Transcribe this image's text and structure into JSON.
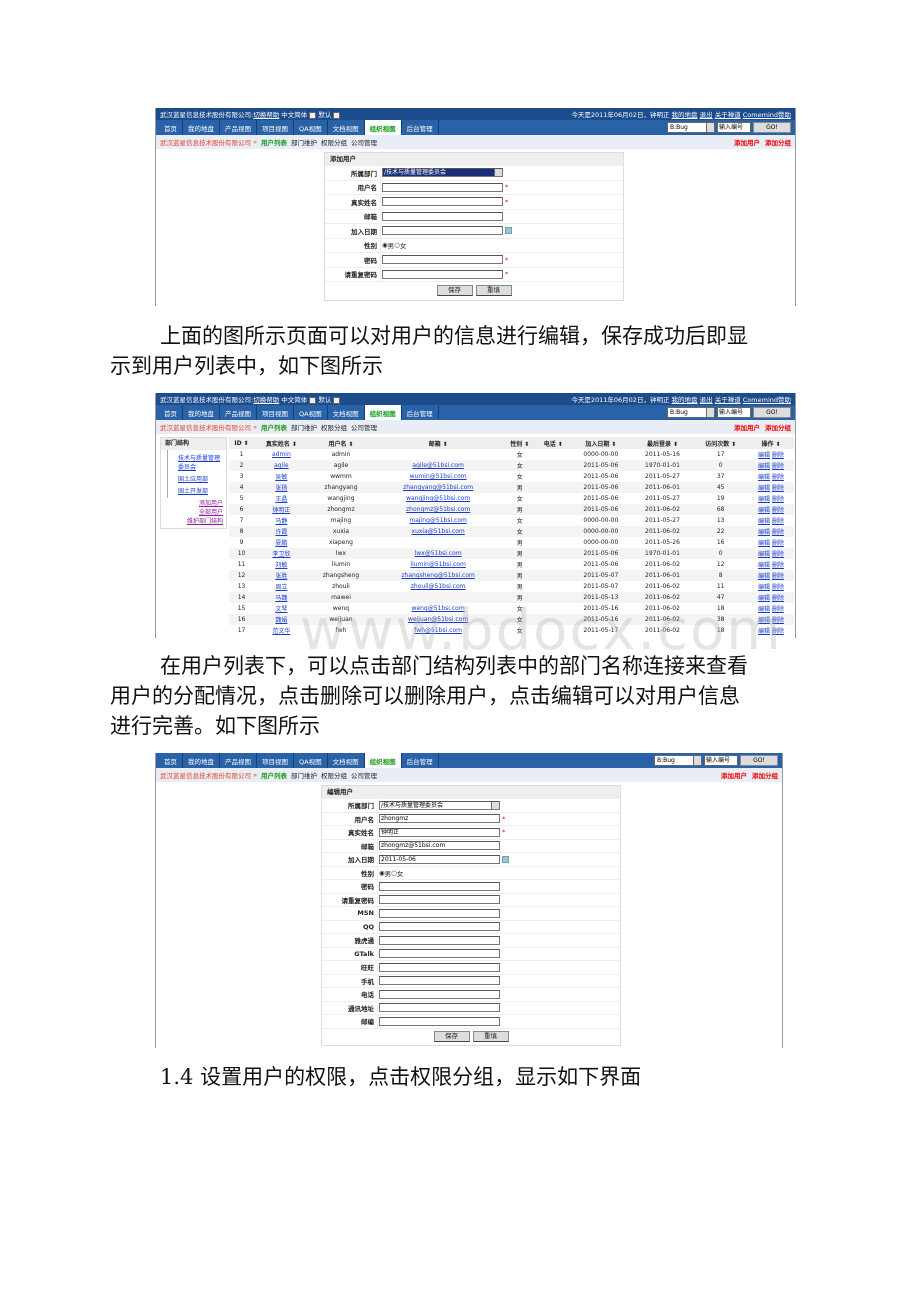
{
  "app": {
    "company": "武汉蓝星信息技术股份有限公司",
    "help": "切换帮助",
    "lang": "中文简体",
    "theme": "默认",
    "today": "今天是2011年06月02日，钟明正",
    "top_links": [
      "我的地盘",
      "退出",
      "关于禅道",
      "Comemind赞助"
    ],
    "tabs": [
      "首页",
      "我的地盘",
      "产品视图",
      "项目视图",
      "QA视图",
      "文档视图",
      "组织视图",
      "后台管理"
    ],
    "active_tab": "组织视图",
    "search_type": "B:Bug",
    "search_placeholder": "输入编号",
    "go": "GO!",
    "sub_current": "用户列表",
    "sub_links": [
      "部门维护",
      "权限分组",
      "公司管理"
    ],
    "sub_actions": [
      "添加用户",
      "添加分组"
    ],
    "colors": {
      "topbar": "#1d4c8c",
      "nav": "#2a62a8",
      "active": "#1a9a1a",
      "action": "#e00000"
    }
  },
  "add_form": {
    "title": "添加用户",
    "rows": [
      {
        "label": "所属部门",
        "type": "select",
        "value": "/技术与质量管理委员会"
      },
      {
        "label": "用户名",
        "type": "text",
        "value": "",
        "required": true
      },
      {
        "label": "真实姓名",
        "type": "text",
        "value": "",
        "required": true
      },
      {
        "label": "邮箱",
        "type": "text",
        "value": ""
      },
      {
        "label": "加入日期",
        "type": "date",
        "value": ""
      },
      {
        "label": "性别",
        "type": "radio",
        "options": [
          "男",
          "女"
        ],
        "selected": "男"
      },
      {
        "label": "密码",
        "type": "password",
        "value": "",
        "required": true
      },
      {
        "label": "请重复密码",
        "type": "password",
        "value": "",
        "required": true
      }
    ],
    "save": "保存",
    "reset": "重填"
  },
  "para1": [
    "上面的图所示页面可以对用户的信息进行编辑，保存成功后即显",
    "示到用户列表中，如下图所示"
  ],
  "user_list": {
    "side_title": "部门结构",
    "departments": [
      "技术与质量管理委员会",
      "国土应用部",
      "国土开发部"
    ],
    "side_links": [
      "添加用户",
      "全部用户",
      "维护部门结构"
    ],
    "columns": [
      "ID",
      "真实姓名",
      "用户名",
      "邮箱",
      "性别",
      "电话",
      "加入日期",
      "最后登录",
      "访问次数",
      "操作"
    ],
    "actions": [
      "编辑",
      "删除"
    ],
    "rows": [
      [
        "1",
        "admin",
        "admin",
        "",
        "女",
        "",
        "0000-00-00",
        "2011-05-16",
        "17"
      ],
      [
        "2",
        "agile",
        "agile",
        "agile@51bsi.com",
        "女",
        "",
        "2011-05-06",
        "1970-01-01",
        "0"
      ],
      [
        "3",
        "吴敏",
        "wwmm",
        "wumin@51bsi.com",
        "女",
        "",
        "2011-05-06",
        "2011-05-27",
        "37"
      ],
      [
        "4",
        "张扬",
        "zhangyang",
        "zhangyang@51bsi.com",
        "男",
        "",
        "2011-05-06",
        "2011-06-01",
        "45"
      ],
      [
        "5",
        "王晶",
        "wangjing",
        "wangjing@51bsi.com",
        "女",
        "",
        "2011-05-06",
        "2011-05-27",
        "19"
      ],
      [
        "6",
        "钟明正",
        "zhongmz",
        "zhongmz@51bsi.com",
        "男",
        "",
        "2011-05-06",
        "2011-06-02",
        "68"
      ],
      [
        "7",
        "马静",
        "majing",
        "majing@51bsi.com",
        "女",
        "",
        "0000-00-00",
        "2011-05-27",
        "13"
      ],
      [
        "8",
        "许霞",
        "xuxia",
        "xuxia@51bsi.com",
        "女",
        "",
        "0000-00-00",
        "2011-06-02",
        "22"
      ],
      [
        "9",
        "夏鹏",
        "xiapeng",
        "",
        "男",
        "",
        "0000-00-00",
        "2011-05-26",
        "16"
      ],
      [
        "10",
        "李卫欣",
        "lwx",
        "lwx@51bsi.com",
        "男",
        "",
        "2011-05-06",
        "1970-01-01",
        "0"
      ],
      [
        "11",
        "刘敏",
        "liumin",
        "liumin@51bsi.com",
        "男",
        "",
        "2011-05-06",
        "2011-06-02",
        "12"
      ],
      [
        "12",
        "张胜",
        "zhangsheng",
        "zhangsheng@51bsi.com",
        "男",
        "",
        "2011-05-07",
        "2011-06-01",
        "8"
      ],
      [
        "13",
        "周立",
        "zhouli",
        "zhouli@51bsi.com",
        "男",
        "",
        "2011-05-07",
        "2011-06-02",
        "11"
      ],
      [
        "14",
        "马魏",
        "mawei",
        "",
        "男",
        "",
        "2011-05-13",
        "2011-06-02",
        "47"
      ],
      [
        "15",
        "文琴",
        "wenq",
        "wenq@51bsi.com",
        "女",
        "",
        "2011-05-16",
        "2011-06-02",
        "18"
      ],
      [
        "16",
        "魏娟",
        "weijuan",
        "weijuan@51bsi.com",
        "女",
        "",
        "2011-05-16",
        "2011-06-02",
        "38"
      ],
      [
        "17",
        "范文华",
        "fwh",
        "fwh@51bsi.com",
        "女",
        "",
        "2011-05-17",
        "2011-06-02",
        "18"
      ]
    ]
  },
  "watermark": "www.bdocx.com",
  "para2": [
    "在用户列表下，可以点击部门结构列表中的部门名称连接来查看",
    "用户的分配情况，点击删除可以删除用户，点击编辑可以对用户信息",
    "进行完善。如下图所示"
  ],
  "edit_form": {
    "title": "编辑用户",
    "rows": [
      {
        "label": "所属部门",
        "type": "select2",
        "value": "/技术与质量管理委员会"
      },
      {
        "label": "用户名",
        "type": "text",
        "value": "zhongmz",
        "required": true
      },
      {
        "label": "真实姓名",
        "type": "text",
        "value": "钟明正",
        "required": true
      },
      {
        "label": "邮箱",
        "type": "text",
        "value": "zhongmz@51bsi.com"
      },
      {
        "label": "加入日期",
        "type": "date",
        "value": "2011-05-06"
      },
      {
        "label": "性别",
        "type": "radio",
        "options": [
          "男",
          "女"
        ],
        "selected": "男"
      },
      {
        "label": "密码",
        "type": "password",
        "value": ""
      },
      {
        "label": "请重复密码",
        "type": "password",
        "value": ""
      },
      {
        "label": "MSN",
        "type": "text",
        "value": ""
      },
      {
        "label": "QQ",
        "type": "text",
        "value": ""
      },
      {
        "label": "雅虎通",
        "type": "text",
        "value": ""
      },
      {
        "label": "GTalk",
        "type": "text",
        "value": ""
      },
      {
        "label": "旺旺",
        "type": "text",
        "value": ""
      },
      {
        "label": "手机",
        "type": "text",
        "value": ""
      },
      {
        "label": "电话",
        "type": "text",
        "value": ""
      },
      {
        "label": "通讯地址",
        "type": "text",
        "value": ""
      },
      {
        "label": "邮编",
        "type": "text",
        "value": ""
      }
    ],
    "save": "保存",
    "reset": "重填"
  },
  "para3": "1.4 设置用户的权限，点击权限分组，显示如下界面"
}
